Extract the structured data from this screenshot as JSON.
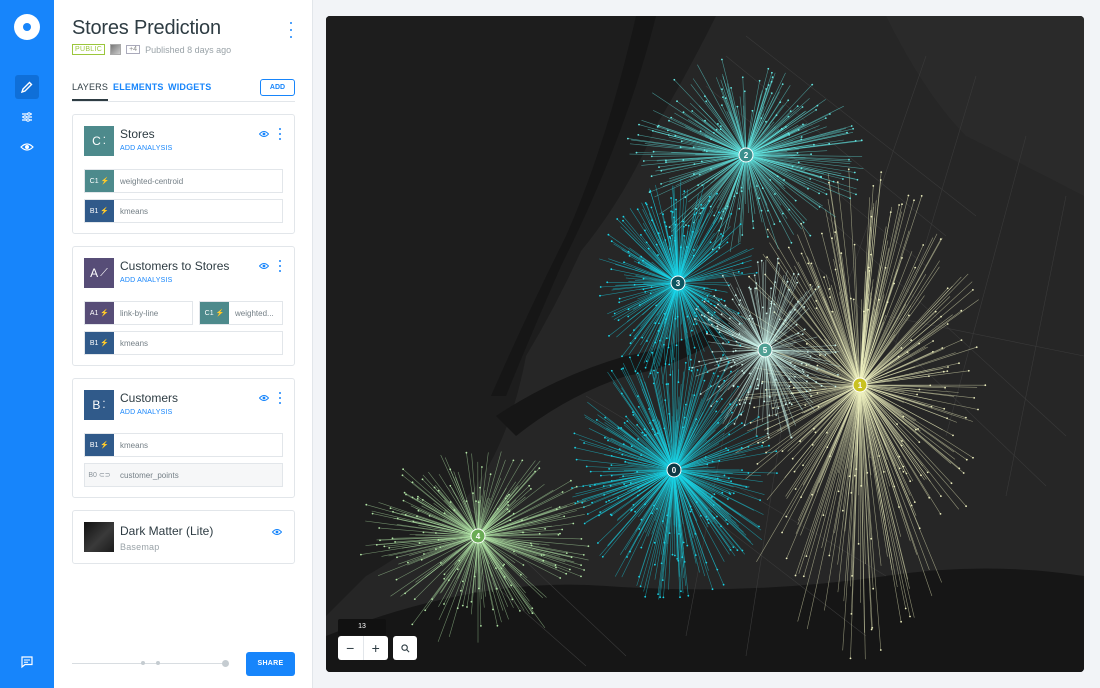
{
  "map_title": "Stores Prediction",
  "meta": {
    "visibility": "PUBLIC",
    "collaborators": "+4",
    "published": "Published 8 days ago"
  },
  "tabs": [
    "LAYERS",
    "ELEMENTS",
    "WIDGETS"
  ],
  "add_button": "ADD",
  "layers": [
    {
      "letter": "C",
      "name": "Stores",
      "add_analysis": "ADD ANALYSIS",
      "nodes": [
        {
          "id": "C1",
          "label": "weighted-centroid"
        },
        {
          "id": "B1",
          "label": "kmeans"
        }
      ]
    },
    {
      "letter": "A",
      "name": "Customers to Stores",
      "add_analysis": "ADD ANALYSIS",
      "nodes": [
        {
          "id": "A1",
          "label": "link-by-line"
        },
        {
          "id": "C1",
          "label": "weighted..."
        },
        {
          "id": "B1",
          "label": "kmeans"
        }
      ]
    },
    {
      "letter": "B",
      "name": "Customers",
      "add_analysis": "ADD ANALYSIS",
      "nodes": [
        {
          "id": "B1",
          "label": "kmeans"
        },
        {
          "id": "B0",
          "label": "customer_points"
        }
      ]
    },
    {
      "name": "Dark Matter (Lite)",
      "subtitle": "Basemap"
    }
  ],
  "share_button": "SHARE",
  "map": {
    "zoom_level": "13",
    "zoom_out": "−",
    "zoom_in": "+",
    "clusters": [
      {
        "label": "0",
        "color": "#19d3e6"
      },
      {
        "label": "1",
        "color": "#eef0bf"
      },
      {
        "label": "2",
        "color": "#63e7e3"
      },
      {
        "label": "3",
        "color": "#19d9ec"
      },
      {
        "label": "4",
        "color": "#b3e6a7"
      },
      {
        "label": "5",
        "color": "#cbf3ea"
      }
    ]
  },
  "colors": {
    "brand": "#1785fb",
    "public_tag": "#9bc63b",
    "node_teal": "#4d8a8c",
    "node_navy": "#305a8a",
    "node_purple": "#574d77"
  }
}
